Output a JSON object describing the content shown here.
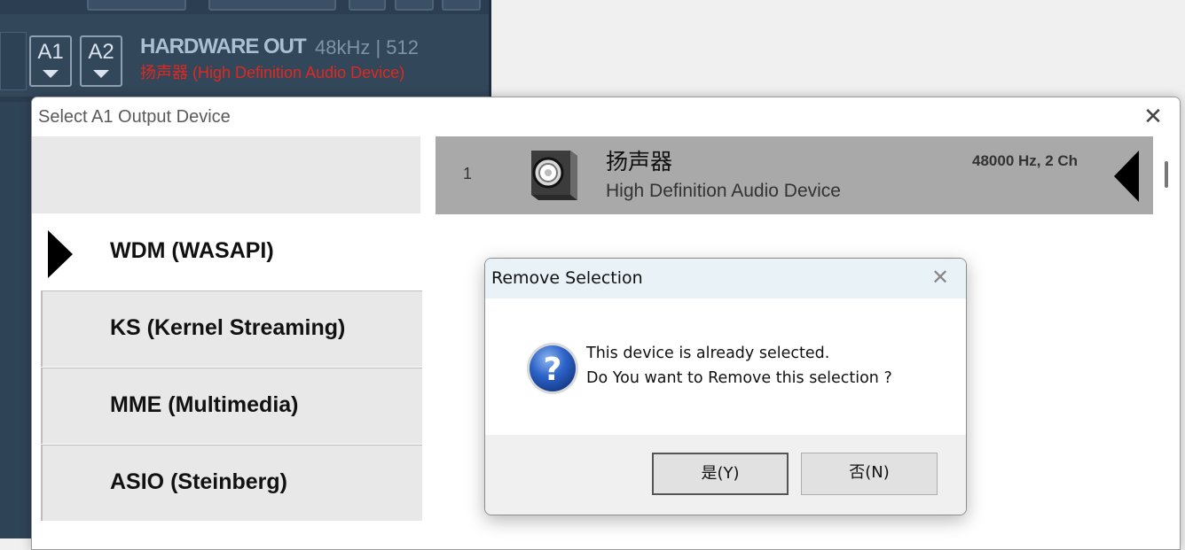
{
  "background_app": {
    "bus_buttons": [
      "A1",
      "A2"
    ],
    "hardware_out_title": "HARDWARE OUT",
    "hardware_out_rate": "48kHz | 512",
    "hardware_out_device": "扬声器 (High Definition Audio Device)"
  },
  "device_window": {
    "title": "Select A1 Output Device",
    "close_glyph": "✕",
    "drivers": [
      {
        "label": "WDM (WASAPI)",
        "selected": true
      },
      {
        "label": "KS (Kernel Streaming)",
        "selected": false
      },
      {
        "label": "MME (Multimedia)",
        "selected": false
      },
      {
        "label": "ASIO (Steinberg)",
        "selected": false
      }
    ],
    "device": {
      "index": "1",
      "name": "扬声器",
      "description": "High Definition Audio Device",
      "format": "48000 Hz, 2 Ch"
    }
  },
  "dialog": {
    "title": "Remove Selection",
    "close_glyph": "✕",
    "message_line1": "This device is already selected.",
    "message_line2": "Do You want to Remove this selection ?",
    "yes_label": "是(Y)",
    "no_label": "否(N)",
    "icon": "question-icon"
  },
  "colors": {
    "app_bg": "#33475b",
    "device_error_red": "#e0281f",
    "selected_row_gray": "#a9a9a9",
    "dialog_title_bg": "#e9f3f7"
  }
}
